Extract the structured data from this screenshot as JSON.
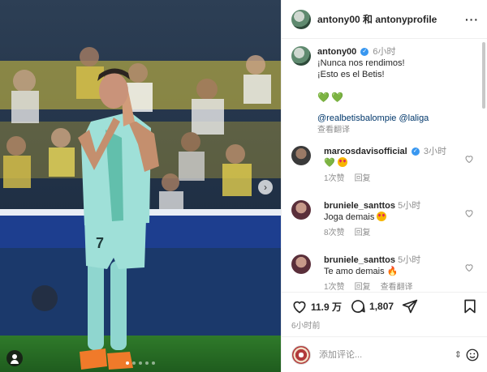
{
  "post": {
    "header_title": "antony00 和 antonyprofile",
    "carousel_index": 1,
    "carousel_count": 5
  },
  "caption": {
    "username": "antony00",
    "time": "6小时",
    "line1": "¡Nunca nos rendimos!",
    "line2": "¡Esto es el Betis!",
    "hearts": "💚💚",
    "tag1": "@realbetisbalompie",
    "tag2": "@laliga",
    "translate": "查看翻译"
  },
  "comments": [
    {
      "username": "marcosdavisofficial",
      "verified": true,
      "time": "3小时",
      "text": "💚",
      "likes": "1次赞",
      "reply": "回复"
    },
    {
      "username": "bruniele_santtos",
      "verified": false,
      "time": "5小时",
      "text": "Joga demais",
      "likes": "8次赞",
      "reply": "回复"
    },
    {
      "username": "bruniele_santtos",
      "verified": false,
      "time": "5小时",
      "text": "Te amo demais",
      "likes": "1次赞",
      "reply": "回复",
      "translate": "查看翻译"
    }
  ],
  "actions": {
    "likes_count": "11.9 万",
    "comments_count": "1,807",
    "posted_time": "6小时前"
  },
  "composer": {
    "placeholder": "添加评论..."
  },
  "colors": {
    "accent_blue": "#3897f0",
    "link_blue": "#00376b",
    "muted": "#8e8e8e",
    "betis_green": "#1e9e3e"
  },
  "icons": [
    "user-tag-icon",
    "chevron-right-icon",
    "more-icon",
    "verified-icon",
    "heart-icon",
    "comment-icon",
    "share-icon",
    "bookmark-icon",
    "emoji-icon"
  ]
}
